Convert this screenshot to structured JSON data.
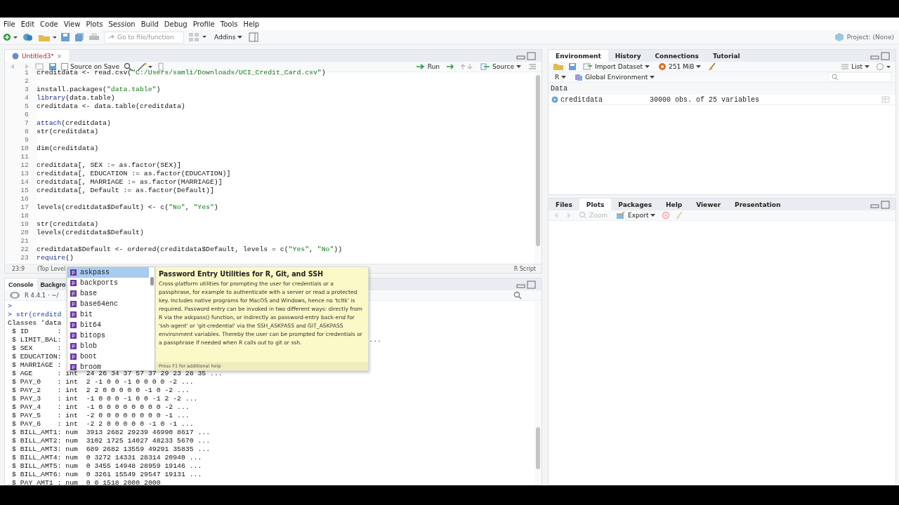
{
  "menu": [
    "File",
    "Edit",
    "Code",
    "View",
    "Plots",
    "Session",
    "Build",
    "Debug",
    "Profile",
    "Tools",
    "Help"
  ],
  "toolbar": {
    "goto_placeholder": "Go to file/function",
    "addins": "Addins",
    "project": "Project: (None)"
  },
  "editor": {
    "tab": {
      "label": "Untitled3*",
      "close": "×",
      "selected": true
    },
    "source_on_save": {
      "label": "Source on Save",
      "checked": false
    },
    "run": "Run",
    "source": "Source",
    "lines": [
      {
        "num": "1",
        "parts": [
          {
            "text": "creditdata <- read.csv(",
            "kind": "plain"
          },
          {
            "text": "\"C:/Users/samli/Downloads/UCI_Credit_Card.csv\"",
            "kind": "string"
          },
          {
            "text": ")",
            "kind": "plain"
          }
        ]
      },
      {
        "num": "2"
      },
      {
        "num": "3",
        "parts": [
          {
            "text": "install.packages(",
            "kind": "plain"
          },
          {
            "text": "\"data.table\"",
            "kind": "string"
          },
          {
            "text": ")",
            "kind": "plain"
          }
        ]
      },
      {
        "num": "4",
        "parts": [
          {
            "text": "library",
            "kind": "keyword"
          },
          {
            "text": "(data.table)",
            "kind": "plain"
          }
        ]
      },
      {
        "num": "5",
        "parts": [
          {
            "text": "creditdata <- data.table(creditdata)",
            "kind": "plain"
          }
        ]
      },
      {
        "num": "6"
      },
      {
        "num": "7",
        "parts": [
          {
            "text": "attach",
            "kind": "keyword"
          },
          {
            "text": "(creditdata)",
            "kind": "plain"
          }
        ]
      },
      {
        "num": "8",
        "parts": [
          {
            "text": "str(creditdata)",
            "kind": "plain"
          }
        ]
      },
      {
        "num": "9"
      },
      {
        "num": "10",
        "parts": [
          {
            "text": "dim(creditdata)",
            "kind": "plain"
          }
        ]
      },
      {
        "num": "11"
      },
      {
        "num": "12",
        "parts": [
          {
            "text": "creditdata[, SEX := as.factor(SEX)]",
            "kind": "plain"
          }
        ]
      },
      {
        "num": "13",
        "parts": [
          {
            "text": "creditdata[, EDUCATION := as.factor(EDUCATION)]",
            "kind": "plain"
          }
        ]
      },
      {
        "num": "14",
        "parts": [
          {
            "text": "creditdata[, MARRIAGE := as.factor(MARRIAGE)]",
            "kind": "plain"
          }
        ]
      },
      {
        "num": "15",
        "parts": [
          {
            "text": "creditdata[, Default := as.factor(Default)]",
            "kind": "plain"
          }
        ]
      },
      {
        "num": "16"
      },
      {
        "num": "17",
        "parts": [
          {
            "text": "levels(creditdata$Default) <- c(",
            "kind": "plain"
          },
          {
            "text": "\"No\"",
            "kind": "string"
          },
          {
            "text": ", ",
            "kind": "plain"
          },
          {
            "text": "\"Yes\"",
            "kind": "string"
          },
          {
            "text": ")",
            "kind": "plain"
          }
        ]
      },
      {
        "num": "18"
      },
      {
        "num": "19",
        "parts": [
          {
            "text": "str(creditdata)",
            "kind": "plain"
          }
        ]
      },
      {
        "num": "20",
        "parts": [
          {
            "text": "levels(creditdata$Default)",
            "kind": "plain"
          }
        ]
      },
      {
        "num": "21"
      },
      {
        "num": "22",
        "parts": [
          {
            "text": "creditdata$Default <- ordered(creditdata$Default, levels = c(",
            "kind": "plain"
          },
          {
            "text": "\"Yes\"",
            "kind": "string"
          },
          {
            "text": ", ",
            "kind": "plain"
          },
          {
            "text": "\"No\"",
            "kind": "string"
          },
          {
            "text": "))",
            "kind": "plain"
          }
        ]
      },
      {
        "num": "23",
        "parts": [
          {
            "text": "require",
            "kind": "keyword"
          },
          {
            "text": "()",
            "kind": "plain"
          }
        ]
      }
    ],
    "position": "23:9",
    "scope": "(Top Level",
    "filetype": "R Script"
  },
  "completion": {
    "items": [
      {
        "badge": "p",
        "label": "askpass",
        "selected": true
      },
      {
        "badge": "p",
        "label": "backports",
        "selected": false
      },
      {
        "badge": "p",
        "label": "base",
        "selected": false
      },
      {
        "badge": "p",
        "label": "base64enc",
        "selected": false
      },
      {
        "badge": "p",
        "label": "bit",
        "selected": false
      },
      {
        "badge": "p",
        "label": "bit64",
        "selected": false
      },
      {
        "badge": "p",
        "label": "bitops",
        "selected": false
      },
      {
        "badge": "p",
        "label": "blob",
        "selected": false
      },
      {
        "badge": "p",
        "label": "boot",
        "selected": false
      },
      {
        "badge": "p",
        "label": "broom",
        "selected": false
      }
    ],
    "help_title": "Password Entry Utilities for R, Git, and SSH",
    "help_text": "Cross-platform utilities for prompting the user for credentials or a passphrase, for example to authenticate with a server or read a protected key. Includes native programs for MacOS and Windows, hence no 'tcltk' is required. Password entry can be invoked in two different ways: directly from R via the askpass() function, or indirectly as password-entry back-end for 'ssh-agent' or 'git-credential' via the SSH_ASKPASS and GIT_ASKPASS environment variables. Thereby the user can be prompted for credentials or a passphrase if needed when R calls out to git or ssh.",
    "help_footer": "Press F1 for additional help"
  },
  "console": {
    "tabs": [
      {
        "label": "Console",
        "selected": true
      },
      {
        "label": "Backgro",
        "selected": false
      }
    ],
    "version": "R 4.4.1 · ~/",
    "lines": [
      {
        "kind": "input",
        "text": ">"
      },
      {
        "kind": "input",
        "text": "> str(creditd"
      },
      {
        "kind": "output",
        "text": "Classes 'data"
      },
      {
        "kind": "output",
        "text": " $ ID       :"
      },
      {
        "kind": "output",
        "text": " $ LIMIT_BAL:",
        "tail": "..."
      },
      {
        "kind": "output",
        "text": " $ SEX      :"
      },
      {
        "kind": "output",
        "text": " $ EDUCATION:"
      },
      {
        "kind": "output",
        "text": " $ MARRIAGE :"
      },
      {
        "kind": "output",
        "text": " $ AGE      : int  24 26 34 37 57 37 29 23 28 35 ..."
      },
      {
        "kind": "output",
        "text": " $ PAY_0    : int  2 -1 0 0 -1 0 0 0 0 -2 ..."
      },
      {
        "kind": "output",
        "text": " $ PAY_2    : int  2 2 0 0 0 0 0 -1 0 -2 ..."
      },
      {
        "kind": "output",
        "text": " $ PAY_3    : int  -1 0 0 0 -1 0 0 -1 2 -2 ..."
      },
      {
        "kind": "output",
        "text": " $ PAY_4    : int  -1 0 0 0 0 0 0 0 0 -2 ..."
      },
      {
        "kind": "output",
        "text": " $ PAY_5    : int  -2 0 0 0 0 0 0 0 0 -1 ..."
      },
      {
        "kind": "output",
        "text": " $ PAY_6    : int  -2 2 0 0 0 0 0 -1 0 -1 ..."
      },
      {
        "kind": "output",
        "text": " $ BILL_AMT1: num  3913 2682 29239 46990 8617 ..."
      },
      {
        "kind": "output",
        "text": " $ BILL_AMT2: num  3102 1725 14027 48233 5670 ..."
      },
      {
        "kind": "output",
        "text": " $ BILL_AMT3: num  689 2682 13559 49291 35835 ..."
      },
      {
        "kind": "output",
        "text": " $ BILL_AMT4: num  0 3272 14331 28314 20940 ..."
      },
      {
        "kind": "output",
        "text": " $ BILL_AMT5: num  0 3455 14948 28959 19146 ..."
      },
      {
        "kind": "output",
        "text": " $ BILL_AMT6: num  0 3261 15549 29547 19131 ..."
      },
      {
        "kind": "output",
        "text": " $ PAY_AMT1 : num  0 0 1518 2000 2000"
      }
    ]
  },
  "environment": {
    "tabs": [
      {
        "label": "Environment",
        "selected": true
      },
      {
        "label": "History",
        "selected": false
      },
      {
        "label": "Connections",
        "selected": false
      },
      {
        "label": "Tutorial",
        "selected": false
      }
    ],
    "import": "Import Dataset",
    "memory": "251 MiB",
    "view": "List",
    "language": "R",
    "scope": "Global Environment",
    "section": "Data",
    "rows": [
      {
        "name": "creditdata",
        "value": "30000 obs. of 25 variables"
      }
    ]
  },
  "files": {
    "tabs": [
      {
        "label": "Files",
        "selected": false
      },
      {
        "label": "Plots",
        "selected": true
      },
      {
        "label": "Packages",
        "selected": false
      },
      {
        "label": "Help",
        "selected": false
      },
      {
        "label": "Viewer",
        "selected": false
      },
      {
        "label": "Presentation",
        "selected": false
      }
    ],
    "zoom": {
      "label": "Zoom",
      "disabled": true
    },
    "export": "Export"
  }
}
